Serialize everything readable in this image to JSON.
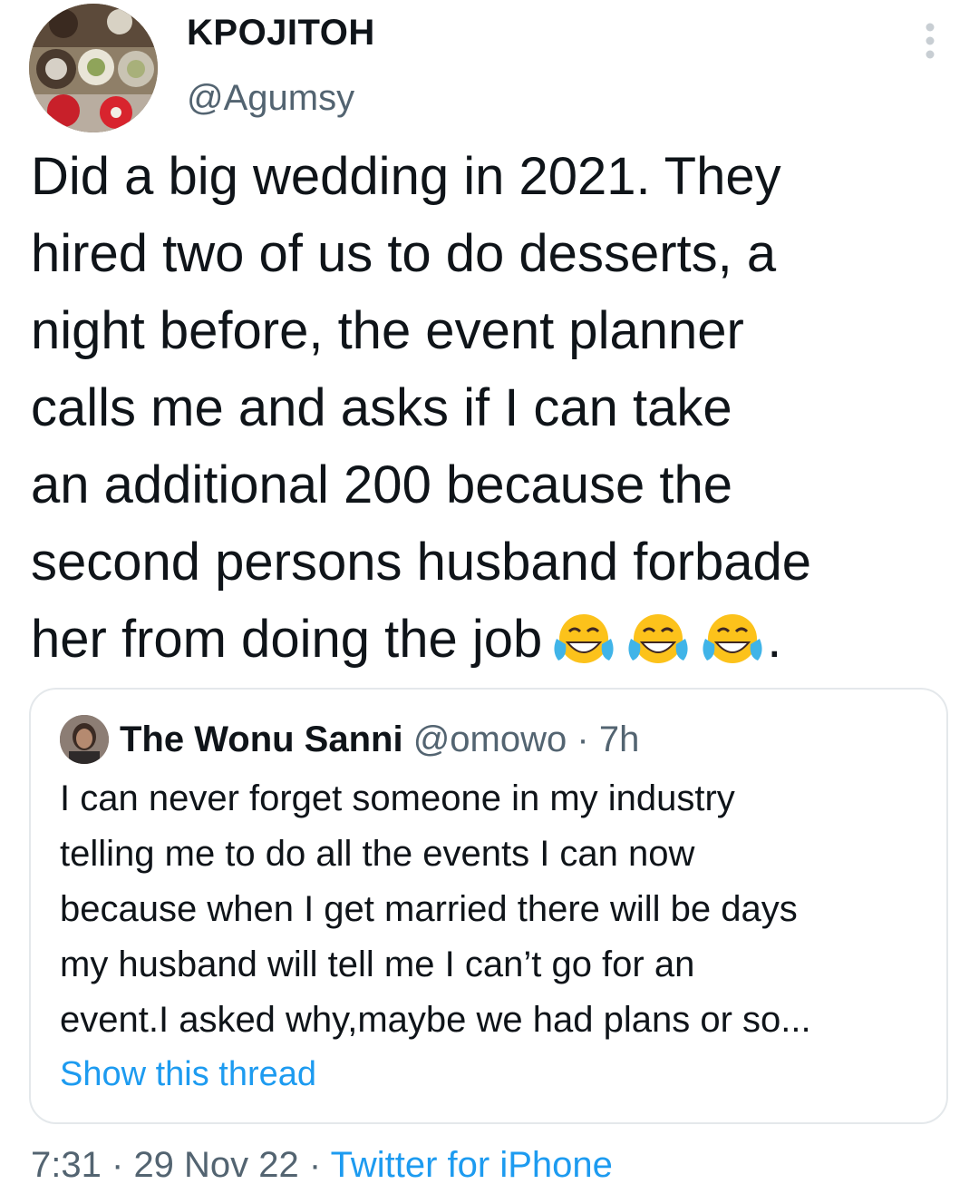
{
  "author": {
    "display_name": "KPOJITOH",
    "handle": "@Agumsy",
    "avatar_icon": "desserts-photo-avatar"
  },
  "more_menu": {
    "icon": "more-vertical-icon"
  },
  "tweet": {
    "text": "Did a big wedding in 2021. They\nhired two of us to do desserts, a\nnight before, the event planner\ncalls me and asks if I can take\nan additional 200 because the\nsecond persons husband forbade\nher from doing the job",
    "trailing_emojis": [
      "face-with-tears-of-joy",
      "face-with-tears-of-joy",
      "face-with-tears-of-joy"
    ],
    "trailing_punct": "."
  },
  "quoted_tweet": {
    "display_name": "The Wonu Sanni",
    "handle": "@omowo",
    "separator": "·",
    "time": "7h",
    "text": "I can never forget someone in my industry\ntelling me to do all the events I can now\nbecause when I get married there will be days\nmy husband will tell me I can’t go for an\nevent.I asked why,maybe we had plans or so...",
    "show_thread_label": "Show this thread"
  },
  "footer": {
    "time": "7:31",
    "sep1": "·",
    "date": "29 Nov 22",
    "sep2": "·",
    "source": "Twitter for iPhone"
  },
  "colors": {
    "text_primary": "#0f1419",
    "text_secondary": "#536471",
    "link": "#1d9bf0",
    "card_border": "#e4e8eb"
  }
}
